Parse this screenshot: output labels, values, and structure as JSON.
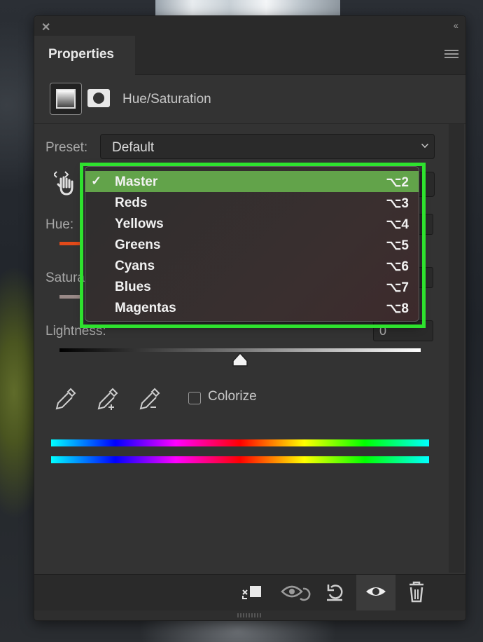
{
  "panel": {
    "tab_title": "Properties",
    "adjustment_title": "Hue/Saturation"
  },
  "controls": {
    "preset_label": "Preset:",
    "preset_value": "Default",
    "hue_label": "Hue:",
    "saturation_label": "Satura",
    "lightness_label": "Lightness:",
    "lightness_value": "0",
    "colorize_label": "Colorize"
  },
  "dropdown": {
    "items": [
      {
        "label": "Master",
        "shortcut": "⌥2",
        "checked": "✓"
      },
      {
        "label": "Reds",
        "shortcut": "⌥3",
        "checked": ""
      },
      {
        "label": "Yellows",
        "shortcut": "⌥4",
        "checked": ""
      },
      {
        "label": "Greens",
        "shortcut": "⌥5",
        "checked": ""
      },
      {
        "label": "Cyans",
        "shortcut": "⌥6",
        "checked": ""
      },
      {
        "label": "Blues",
        "shortcut": "⌥7",
        "checked": ""
      },
      {
        "label": "Magentas",
        "shortcut": "⌥8",
        "checked": ""
      }
    ],
    "selected": "Master"
  },
  "icons": {
    "close": "close-icon",
    "collapse": "collapse-icon",
    "menu": "panel-menu-icon",
    "hand": "targeted-adjustment-hand-icon",
    "eyedroppers": [
      "eyedropper-icon",
      "eyedropper-add-icon",
      "eyedropper-subtract-icon"
    ],
    "footer": [
      "clip-to-layer-icon",
      "view-previous-state-icon",
      "reset-icon",
      "visibility-eye-icon",
      "trash-icon"
    ]
  },
  "colors": {
    "highlight": "#2ee22e",
    "selected_item": "#62a34a",
    "panel_bg": "#333333"
  }
}
